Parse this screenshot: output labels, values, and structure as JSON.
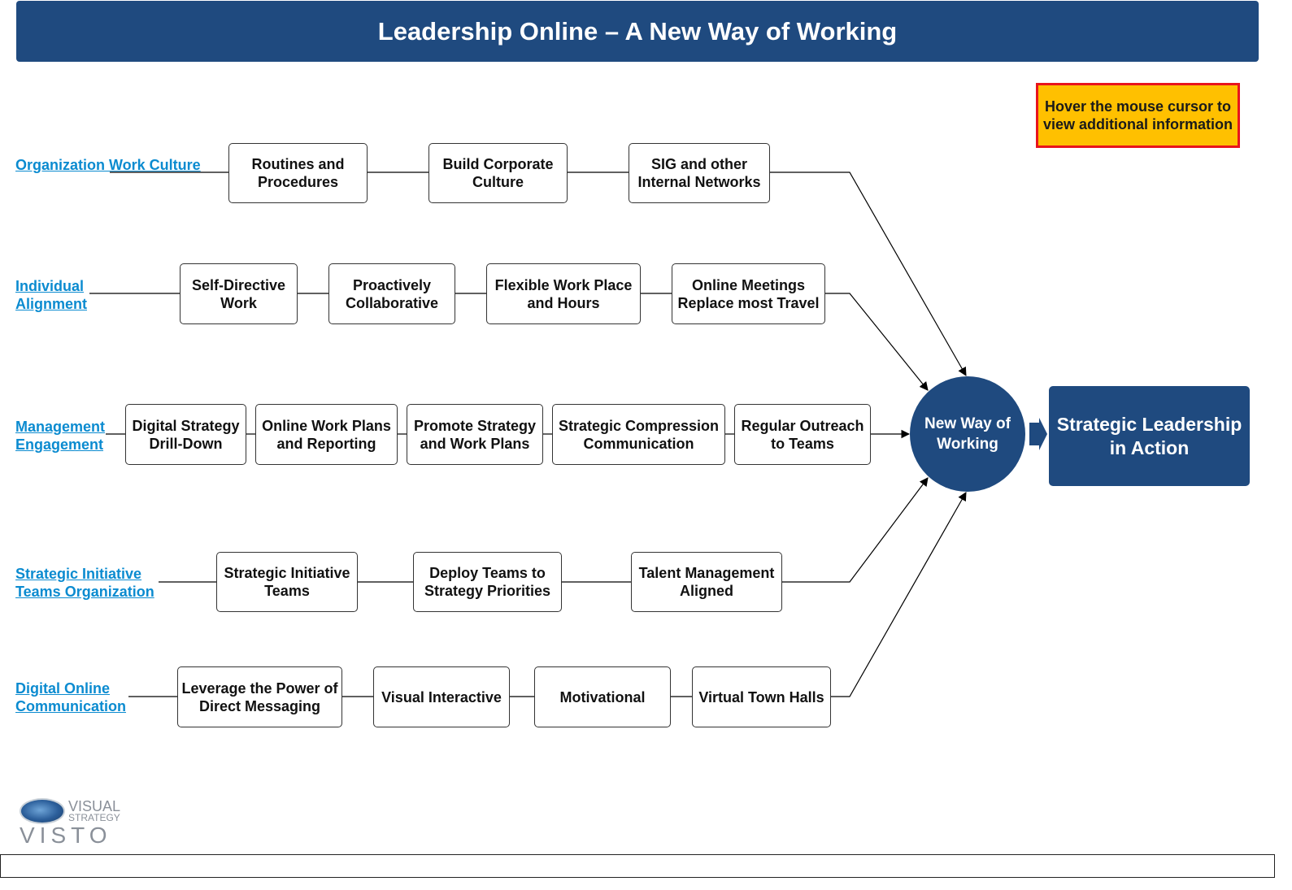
{
  "header": {
    "title": "Leadership Online – A New Way of Working"
  },
  "hint": {
    "text": "Hover the mouse cursor to view additional information"
  },
  "colors": {
    "primary": "#1f4a7f",
    "link": "#0b8bd0",
    "hint_bg": "#ffc000",
    "hint_border": "#e8141c"
  },
  "rows": [
    {
      "label": "Organization Work Culture",
      "items": [
        "Routines and Procedures",
        "Build Corporate Culture",
        "SIG and other Internal Networks"
      ]
    },
    {
      "label": "Individual Alignment",
      "items": [
        "Self-Directive Work",
        "Proactively Collaborative",
        "Flexible Work Place and Hours",
        "Online Meetings Replace most Travel"
      ]
    },
    {
      "label": "Management Engagement",
      "items": [
        "Digital Strategy Drill-Down",
        "Online Work Plans and Reporting",
        "Promote Strategy and Work Plans",
        "Strategic Compression Communication",
        "Regular Outreach to Teams"
      ]
    },
    {
      "label": "Strategic Initiative Teams Organization",
      "items": [
        "Strategic Initiative Teams",
        "Deploy Teams to Strategy Priorities",
        "Talent Management Aligned"
      ]
    },
    {
      "label": "Digital Online Communication",
      "items": [
        "Leverage the Power of Direct Messaging",
        "Visual Interactive",
        "Motivational",
        "Virtual Town Halls"
      ]
    }
  ],
  "hub": {
    "label": "New Way of Working"
  },
  "result": {
    "label": "Strategic Leadership in Action"
  },
  "logo": {
    "top": "VISUAL",
    "middle": "STRATEGY",
    "main": "VISTO"
  }
}
